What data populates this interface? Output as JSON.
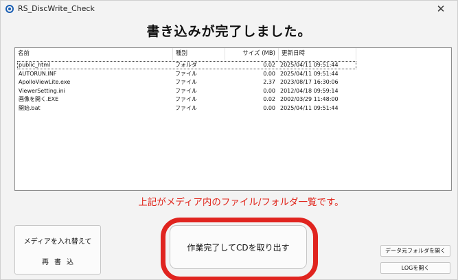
{
  "window": {
    "title": "RS_DiscWrite_Check",
    "close_glyph": "✕"
  },
  "headline": "書き込みが完了しました。",
  "file_list": {
    "columns": [
      "名前",
      "種別",
      "サイズ (MB)",
      "更新日時"
    ],
    "rows": [
      [
        "public_html",
        "フォルダ",
        "0.02",
        "2025/04/11 09:51:44"
      ],
      [
        "AUTORUN.INF",
        "ファイル",
        "0.00",
        "2025/04/11 09:51:44"
      ],
      [
        "ApolloViewLite.exe",
        "ファイル",
        "2.37",
        "2023/08/17 16:30:06"
      ],
      [
        "ViewerSetting.ini",
        "ファイル",
        "0.00",
        "2012/04/18 09:59:14"
      ],
      [
        "画像を開く.EXE",
        "ファイル",
        "0.02",
        "2002/03/29 11:48:00"
      ],
      [
        "開始.bat",
        "ファイル",
        "0.00",
        "2025/04/11 09:51:44"
      ]
    ],
    "selected_index": 0
  },
  "notice": "上記がメディア内のファイル/フォルダ一覧です。",
  "buttons": {
    "replace": {
      "label": "メディアを入れ替えて",
      "sub": "再書込"
    },
    "finish": "作業完了してCDを取り出す",
    "open_data_folder": "データ元フォルダを開く",
    "open_log": "LOGを開く"
  },
  "colors": {
    "highlight_red": "#e0241f",
    "notice_red": "#e0251b",
    "icon_blue": "#1a5fb4"
  }
}
